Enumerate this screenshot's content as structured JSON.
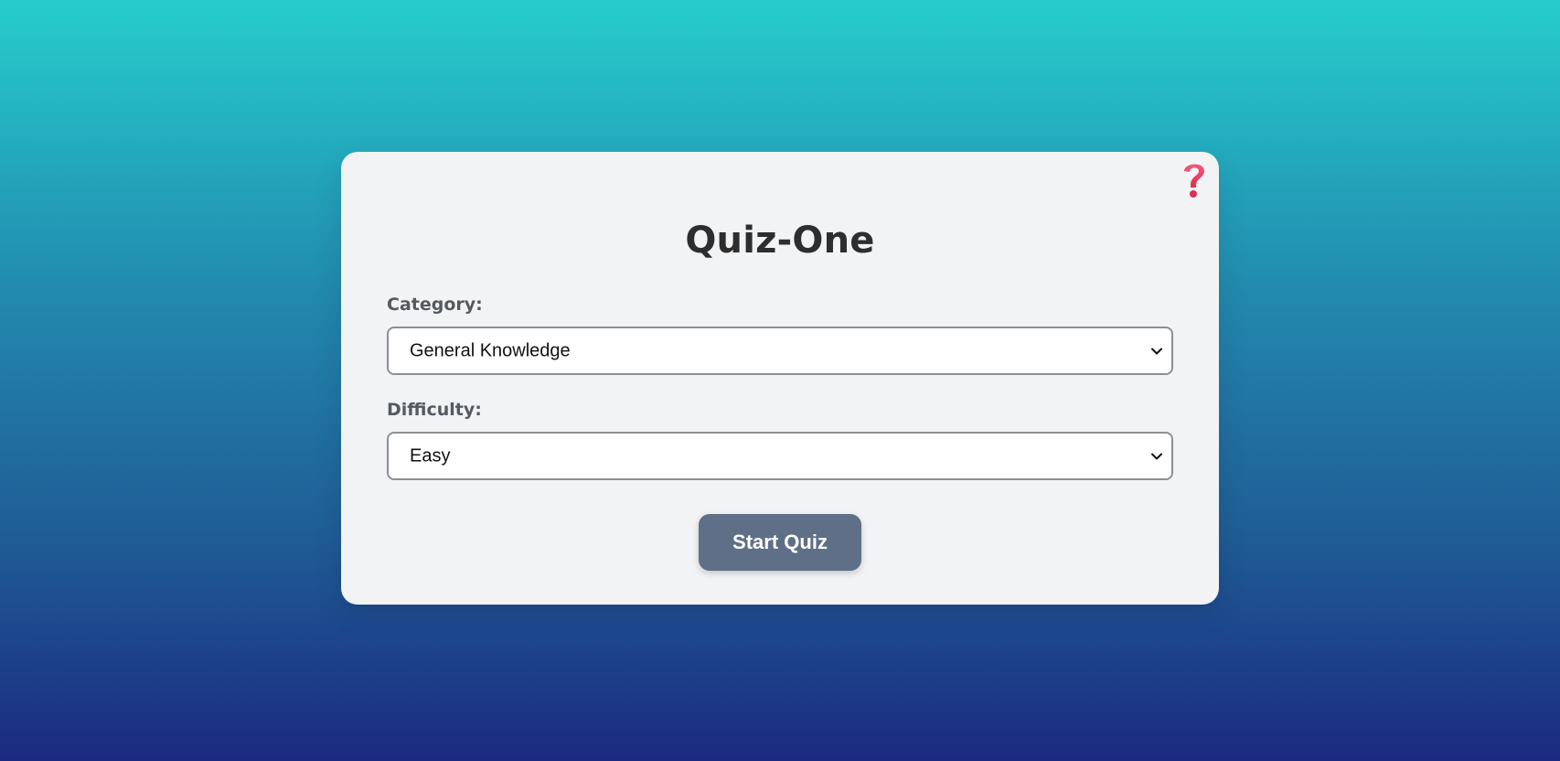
{
  "app": {
    "title": "Quiz-One"
  },
  "help": {
    "icon": "question-mark-icon",
    "color": "#e83a5e"
  },
  "form": {
    "category": {
      "label": "Category:",
      "selected": "General Knowledge"
    },
    "difficulty": {
      "label": "Difficulty:",
      "selected": "Easy"
    },
    "start_label": "Start Quiz"
  },
  "colors": {
    "background_top": "#26cdcc",
    "background_bottom": "#1b2a80",
    "card": "#f2f3f5",
    "button": "#5e6f87",
    "title_text": "#2e2e2e"
  }
}
